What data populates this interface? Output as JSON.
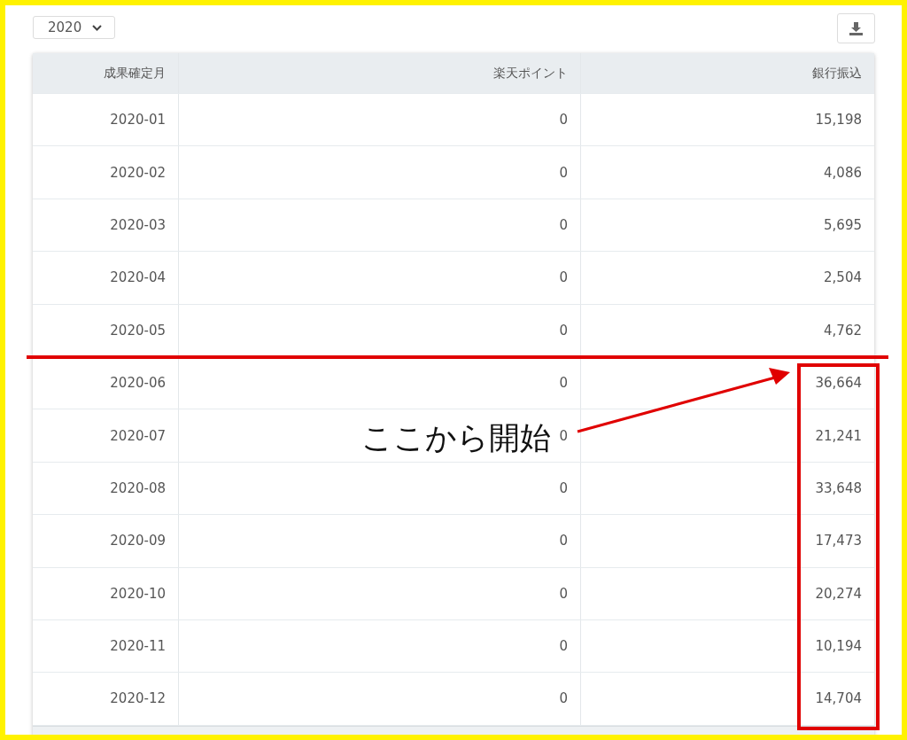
{
  "year_select": {
    "value": "2020"
  },
  "table": {
    "columns": [
      "成果確定月",
      "楽天ポイント",
      "銀行振込"
    ],
    "rows": [
      [
        "2020-01",
        "0",
        "15,198"
      ],
      [
        "2020-02",
        "0",
        "4,086"
      ],
      [
        "2020-03",
        "0",
        "5,695"
      ],
      [
        "2020-04",
        "0",
        "2,504"
      ],
      [
        "2020-05",
        "0",
        "4,762"
      ],
      [
        "2020-06",
        "0",
        "36,664"
      ],
      [
        "2020-07",
        "0",
        "21,241"
      ],
      [
        "2020-08",
        "0",
        "33,648"
      ],
      [
        "2020-09",
        "0",
        "17,473"
      ],
      [
        "2020-10",
        "0",
        "20,274"
      ],
      [
        "2020-11",
        "0",
        "10,194"
      ],
      [
        "2020-12",
        "0",
        "14,704"
      ]
    ]
  },
  "annotation": {
    "label": "ここから開始"
  }
}
